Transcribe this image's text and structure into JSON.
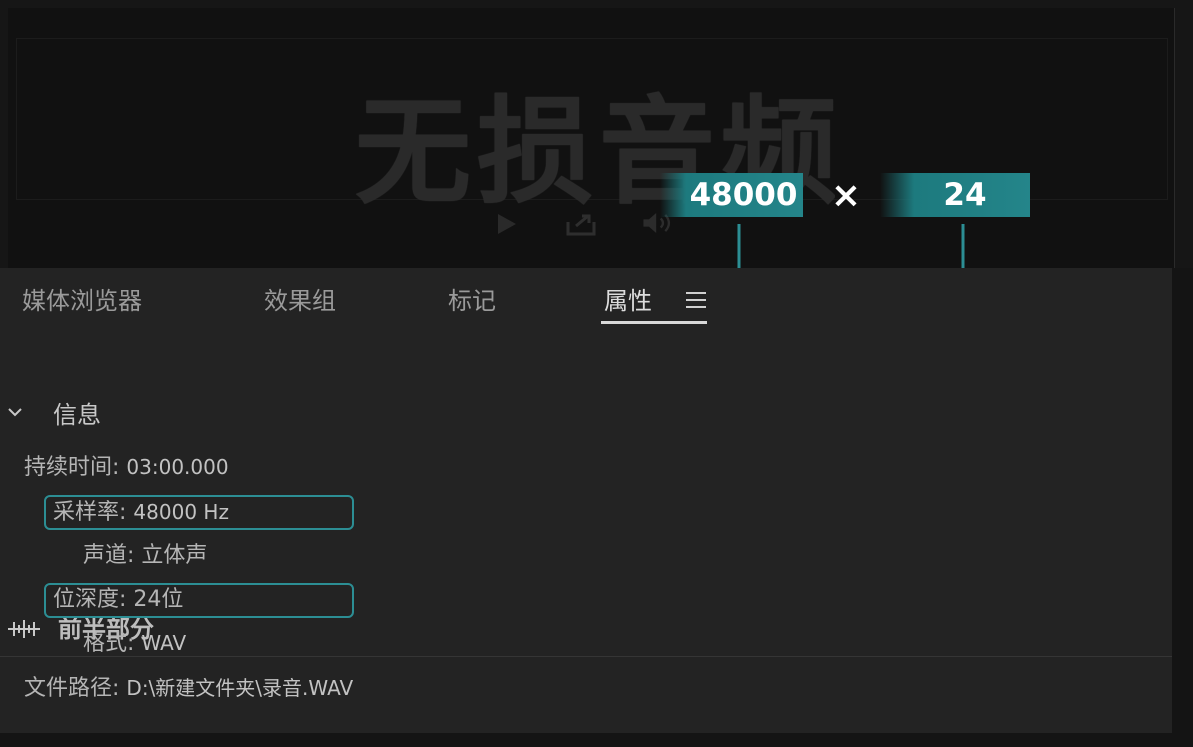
{
  "preview": {
    "watermark": "无损音频",
    "transport": [
      "play-icon",
      "export-icon",
      "volume-icon"
    ]
  },
  "overlay": {
    "sample_rate_badge": "48000",
    "times_symbol": "×",
    "bit_depth_badge": "24",
    "accent": "#24858a"
  },
  "tabs": [
    {
      "label": "媒体浏览器",
      "active": false
    },
    {
      "label": "效果组",
      "active": false
    },
    {
      "label": "标记",
      "active": false
    },
    {
      "label": "属性",
      "active": true
    }
  ],
  "clip": {
    "icon": "audio-clip-icon",
    "name": "前半部分"
  },
  "info_section": {
    "title": "信息",
    "fields": [
      {
        "label": "持续时间:",
        "value": "03:00.000"
      },
      {
        "label": "采样率:",
        "value": "48000 Hz"
      },
      {
        "label": "声道:",
        "value": "立体声"
      },
      {
        "label": "位深度:",
        "value": "24位"
      },
      {
        "label": "格式:",
        "value": "WAV"
      },
      {
        "label": "文件路径:",
        "value": "D:\\新建文件夹\\录音.WAV"
      }
    ]
  }
}
